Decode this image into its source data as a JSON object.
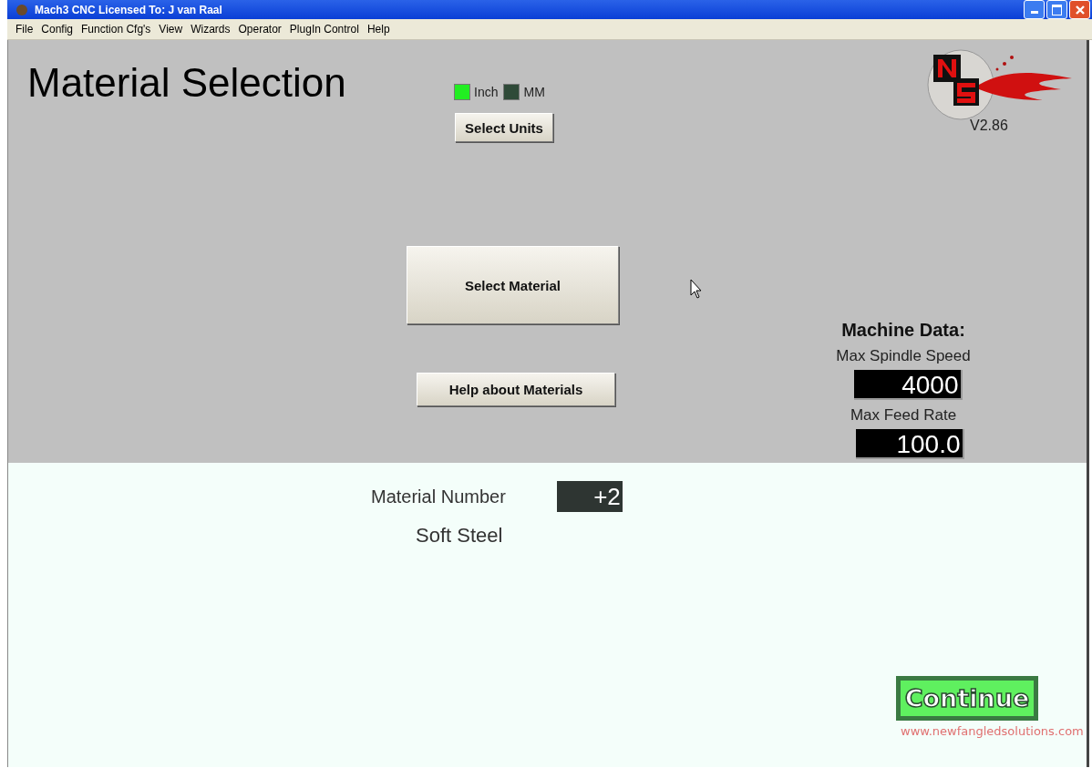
{
  "window": {
    "title": "Mach3 CNC  Licensed To: J van Raal"
  },
  "menu": [
    "File",
    "Config",
    "Function Cfg's",
    "View",
    "Wizards",
    "Operator",
    "PlugIn Control",
    "Help"
  ],
  "screen": {
    "title": "Material Selection",
    "units": [
      {
        "label": "Inch",
        "on": true
      },
      {
        "label": "MM",
        "on": false
      }
    ],
    "select_units_button": "Select Units",
    "version": "V2.86",
    "select_material_button": "Select Material",
    "help_button": "Help about Materials",
    "machine_data": {
      "heading": "Machine Data:",
      "fields": [
        {
          "label": "Max Spindle Speed",
          "value": "4000"
        },
        {
          "label": "Max Feed Rate",
          "value": "100.0"
        }
      ]
    },
    "material_number": {
      "label": "Material Number",
      "value": "+2"
    },
    "material_name": "Soft Steel",
    "continue_button": "Continue",
    "website": "www.newfangledsolutions.com"
  }
}
